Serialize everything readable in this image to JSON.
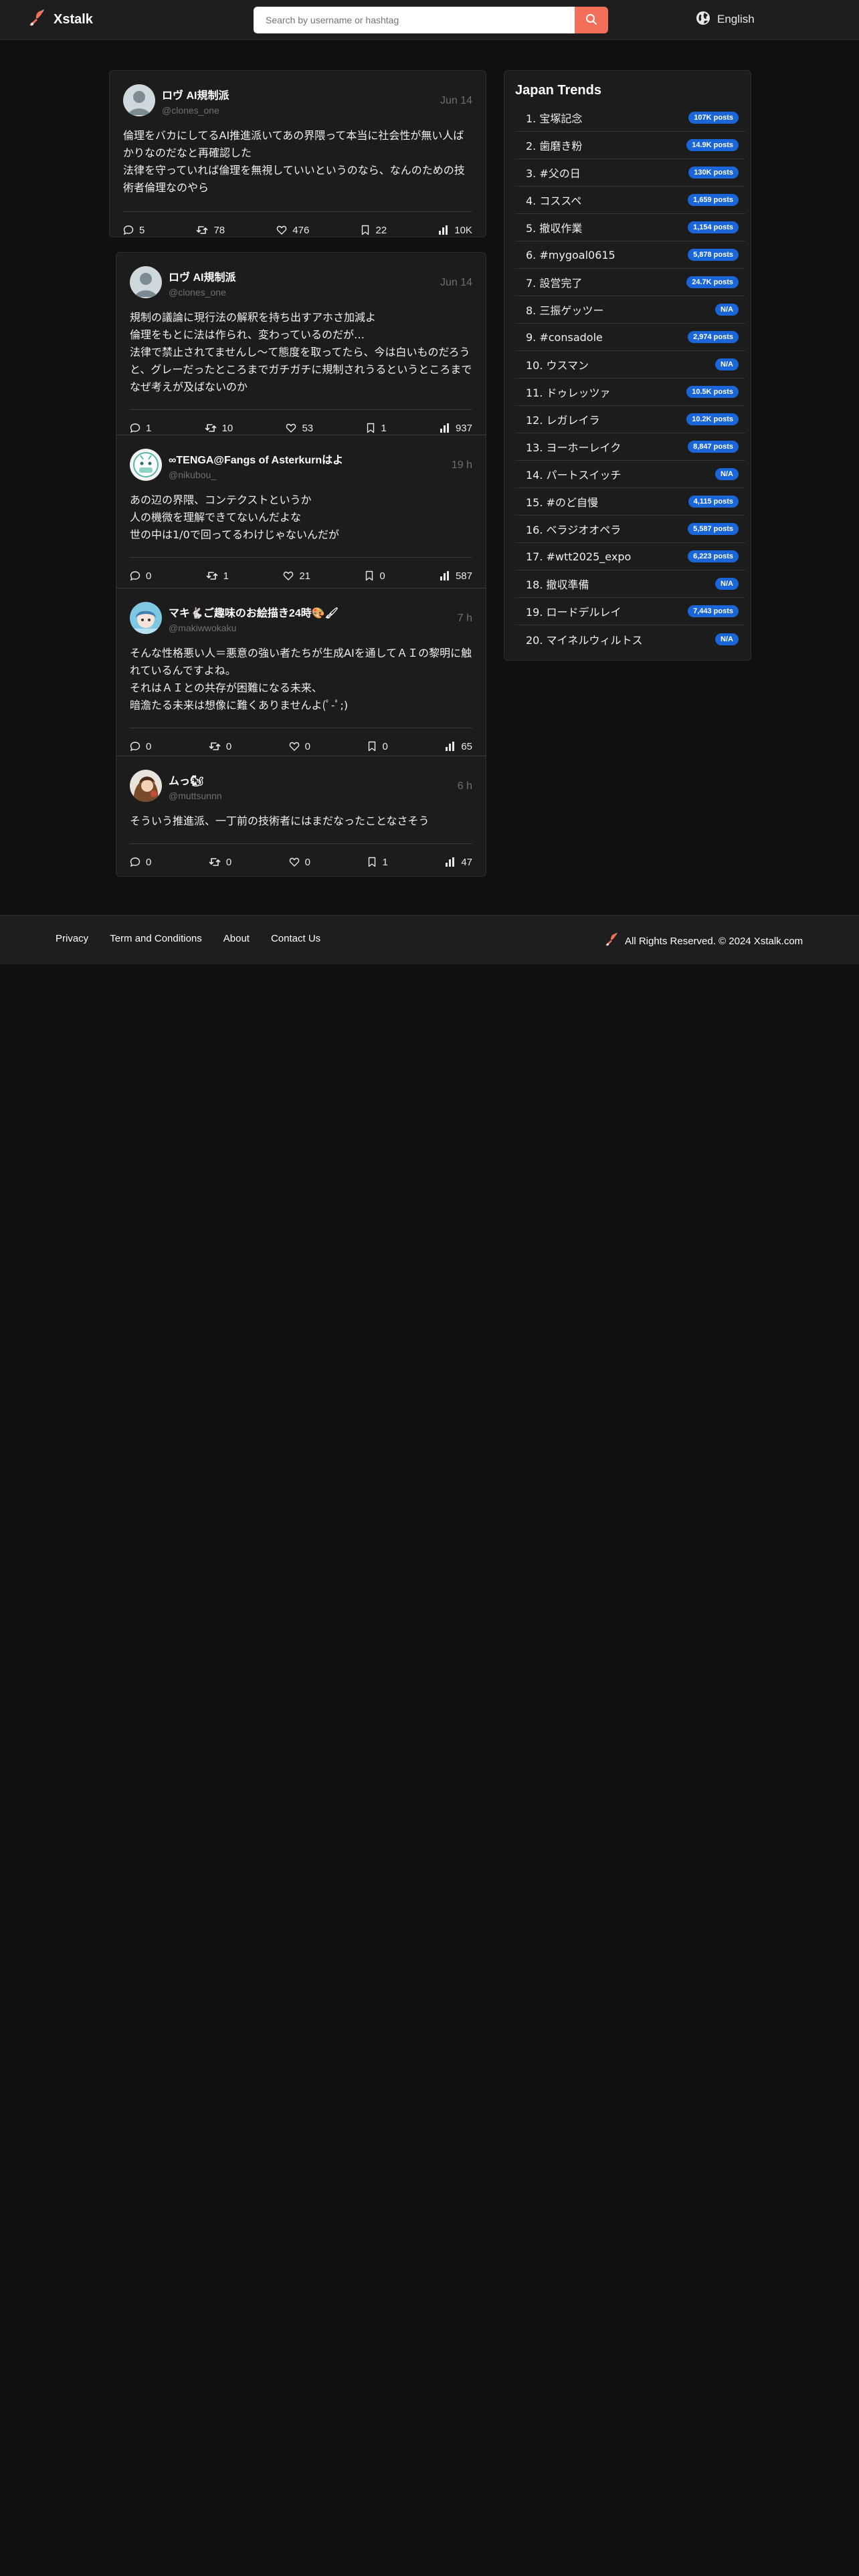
{
  "header": {
    "brand": "Xstalk",
    "search_placeholder": "Search by username or hashtag",
    "language": "English"
  },
  "posts": [
    {
      "name": "ロヴ AI規制派",
      "handle": "@clones_one",
      "time": "Jun 14",
      "text": "倫理をバカにしてるAI推進派いてあの界隈って本当に社会性が無い人ばかりなのだなと再確認した\n法律を守っていれば倫理を無視していいというのなら、なんのための技術者倫理なのやら",
      "replies": "5",
      "reposts": "78",
      "likes": "476",
      "bookmarks": "22",
      "views": "10K"
    },
    {
      "name": "ロヴ AI規制派",
      "handle": "@clones_one",
      "time": "Jun 14",
      "text": "規制の議論に現行法の解釈を持ち出すアホさ加減よ\n倫理をもとに法は作られ、変わっているのだが…\n法律で禁止されてませんし〜て態度を取ってたら、今は白いものだろうと、グレーだったところまでガチガチに規制されうるというところまでなぜ考えが及ばないのか",
      "replies": "1",
      "reposts": "10",
      "likes": "53",
      "bookmarks": "1",
      "views": "937"
    },
    {
      "name": "∞TENGA@Fangs of Asterkurnはよ",
      "handle": "@nikubou_",
      "time": "19 h",
      "text": "あの辺の界隈、コンテクストというか\n人の機微を理解できてないんだよな\n世の中は1/0で回ってるわけじゃないんだが",
      "replies": "0",
      "reposts": "1",
      "likes": "21",
      "bookmarks": "0",
      "views": "587"
    },
    {
      "name": "マキ🐇ご趣味のお絵描き24時🎨🖌",
      "handle": "@makiwwokaku",
      "time": "7 h",
      "text": "そんな性格悪い人＝悪意の強い者たちが生成AIを通してＡＩの黎明に触れているんですよね。\nそれはＡＩとの共存が困難になる未来、\n暗澹たる未来は想像に難くありませんよ(ﾟ-ﾟ;)",
      "replies": "0",
      "reposts": "0",
      "likes": "0",
      "bookmarks": "0",
      "views": "65"
    },
    {
      "name": "ムっ🐿",
      "handle": "@muttsunnn",
      "time": "6 h",
      "text": "そういう推進派、一丁前の技術者にはまだなったことなさそう",
      "replies": "0",
      "reposts": "0",
      "likes": "0",
      "bookmarks": "1",
      "views": "47"
    }
  ],
  "trends": {
    "title": "Japan Trends",
    "items": [
      {
        "label": "1. 宝塚記念",
        "count": "107K posts"
      },
      {
        "label": "2. 歯磨き粉",
        "count": "14.9K posts"
      },
      {
        "label": "3. #父の日",
        "count": "130K posts"
      },
      {
        "label": "4. コススペ",
        "count": "1,659 posts"
      },
      {
        "label": "5. 撤収作業",
        "count": "1,154 posts"
      },
      {
        "label": "6. #mygoal0615",
        "count": "5,878 posts"
      },
      {
        "label": "7. 設営完了",
        "count": "24.7K posts"
      },
      {
        "label": "8. 三振ゲッツー",
        "count": "N/A"
      },
      {
        "label": "9. #consadole",
        "count": "2,974 posts"
      },
      {
        "label": "10. ウスマン",
        "count": "N/A"
      },
      {
        "label": "11. ドゥレッツァ",
        "count": "10.5K posts"
      },
      {
        "label": "12. レガレイラ",
        "count": "10.2K posts"
      },
      {
        "label": "13. ヨーホーレイク",
        "count": "8,847 posts"
      },
      {
        "label": "14. パートスイッチ",
        "count": "N/A"
      },
      {
        "label": "15. #のど自慢",
        "count": "4,115 posts"
      },
      {
        "label": "16. ベラジオオペラ",
        "count": "5,587 posts"
      },
      {
        "label": "17. #wtt2025_expo",
        "count": "6,223 posts"
      },
      {
        "label": "18. 撤収準備",
        "count": "N/A"
      },
      {
        "label": "19. ロードデルレイ",
        "count": "7,443 posts"
      },
      {
        "label": "20. マイネルウィルトス",
        "count": "N/A"
      }
    ]
  },
  "footer": {
    "links": [
      "Privacy",
      "Term and Conditions",
      "About",
      "Contact Us"
    ],
    "copyright": "All Rights Reserved. © 2024 Xstalk.com"
  },
  "colors": {
    "background": "#101010",
    "card": "#1c1c1c",
    "accent": "#f27059",
    "badge": "#1a66d8"
  }
}
